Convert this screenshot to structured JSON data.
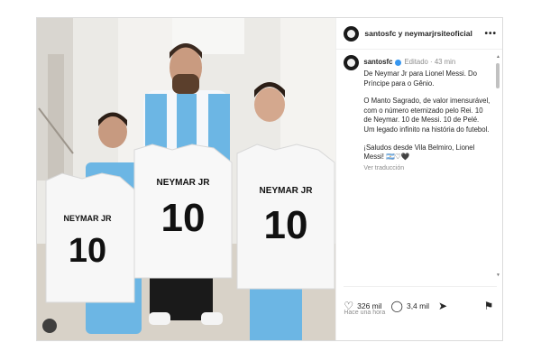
{
  "post": {
    "header_title": "santosfc y neymarjrsiteoficial",
    "more_label": "•••",
    "author": "santosfc",
    "edited_label": "Editado",
    "age": "43 min",
    "paragraphs": [
      "De Neymar Jr para Lionel Messi. Do Príncipe para o Gênio.",
      "O Manto Sagrado, de valor imensurável, com o número eternizado pelo Rei. 10 de Neymar. 10 de Messi. 10 de Pelé. Um legado infinito na história do futebol.",
      "¡Saludos desde Vila Belmiro, Lionel Messi! 🇦🇷♡🖤"
    ],
    "translate_label": "Ver traducción",
    "likes": "326 mil",
    "comments": "3,4 mil",
    "timestamp": "Hace una hora"
  },
  "photo": {
    "jersey_name": "NEYMAR JR",
    "jersey_number": "10"
  },
  "icons": {
    "like": "heart-icon",
    "comment": "comment-icon",
    "share": "share-icon",
    "save": "bookmark-icon",
    "tag": "person-icon"
  },
  "colors": {
    "verified": "#3897f0",
    "argentina_blue": "#6cb6e4"
  }
}
